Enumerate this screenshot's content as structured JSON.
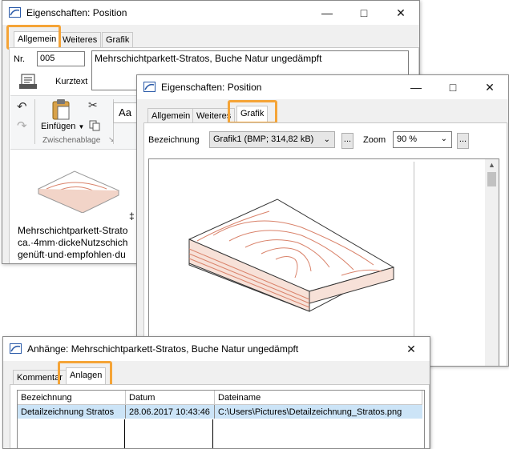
{
  "win1": {
    "title": "Eigenschaften: Position",
    "tabs": [
      "Allgemein",
      "Weiteres",
      "Grafik"
    ],
    "nr_label": "Nr.",
    "nr_value": "005",
    "description": "Mehrschichtparkett-Stratos, Buche Natur ungedämpft",
    "kurztext_label": "Kurztext",
    "ribbon": {
      "paste_label": "Einfügen",
      "group_label": "Zwischenablage",
      "font_btn": "Aa"
    },
    "body_lines": [
      "Mehrschichtparkett-Strato",
      "ca.·4mm·dickeNutzschich",
      "genüft·und·empfohlen·du"
    ]
  },
  "win2": {
    "title": "Eigenschaften: Position",
    "tabs": [
      "Allgemein",
      "Weiteres",
      "Grafik"
    ],
    "bezeichnung_label": "Bezeichnung",
    "bezeichnung_value": "Grafik1 (BMP; 314,82 kB)",
    "zoom_label": "Zoom",
    "zoom_value": "90 %",
    "dots": "..."
  },
  "win3": {
    "title": "Anhänge: Mehrschichtparkett-Stratos, Buche Natur ungedämpft",
    "tabs": [
      "Kommentar",
      "Anlagen"
    ],
    "columns": [
      "Bezeichnung",
      "Datum",
      "Dateiname"
    ],
    "rows": [
      [
        "Detailzeichnung Stratos",
        "28.06.2017 10:43:46",
        "C:\\Users\\Pictures\\Detailzeichnung_Stratos.png"
      ]
    ]
  },
  "colors": {
    "highlight": "#f5a437",
    "selection": "#cce4f7",
    "wood_grain": "#d9826a"
  }
}
